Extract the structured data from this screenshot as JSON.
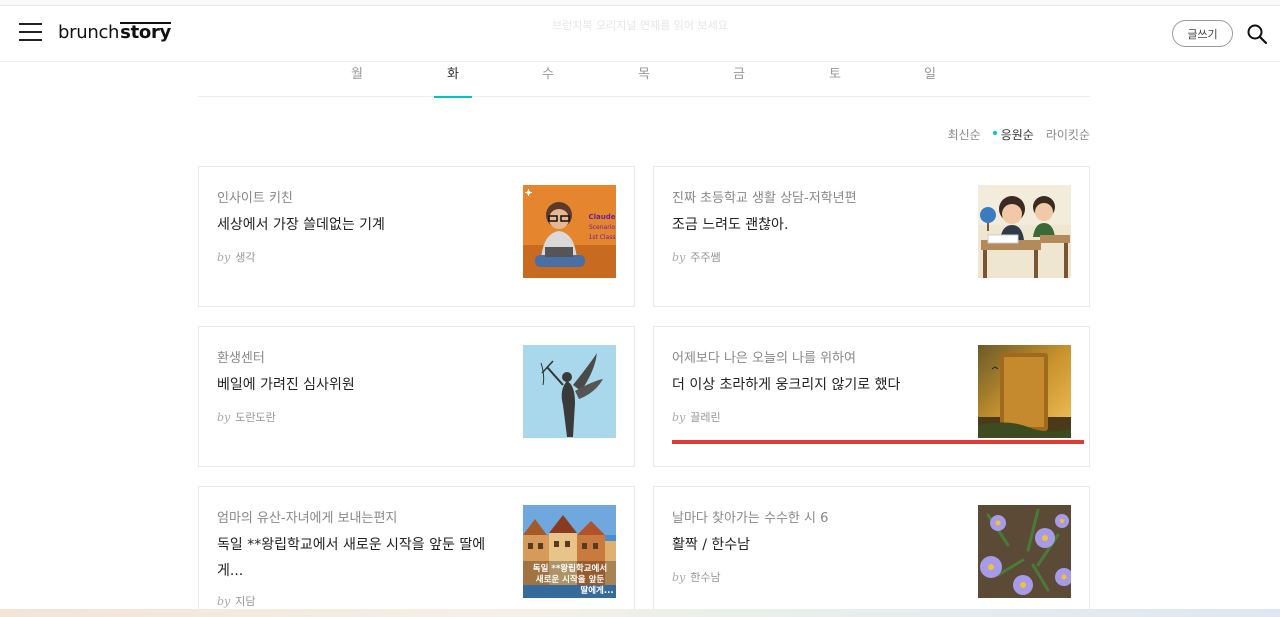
{
  "header": {
    "logo_part1": "brunch",
    "logo_part2": "story",
    "hint": "브런치북 오리지널 연재를 읽어 보세요",
    "write_label": "글쓰기"
  },
  "days": [
    "월",
    "화",
    "수",
    "목",
    "금",
    "토",
    "일"
  ],
  "active_day": "화",
  "sort": [
    "최신순",
    "응원순",
    "라이킷순"
  ],
  "active_sort": "응원순",
  "cards": [
    {
      "category": "인사이트 키친",
      "title": "세상에서 가장 쓸데없는 기계",
      "by": "by",
      "author": "생각",
      "thumb_text": [
        "Claude",
        "Scenario",
        "1st Class"
      ]
    },
    {
      "category": "진짜 초등학교 생활 상담-저학년편",
      "title": "조금 느려도 괜찮아.",
      "by": "by",
      "author": "주주쌤"
    },
    {
      "category": "환생센터",
      "title": "베일에 가려진 심사위원",
      "by": "by",
      "author": "도란도란"
    },
    {
      "category": "어제보다 나은 오늘의 나를 위하여",
      "title": "더 이상 초라하게 웅크리지 않기로 했다",
      "by": "by",
      "author": "끌레린"
    },
    {
      "category": "엄마의 유산-자녀에게 보내는편지",
      "title": "독일 **왕립학교에서 새로운 시작을 앞둔 딸에게...",
      "by": "by",
      "author": "지담",
      "thumb_text": [
        "독일 **왕립학교에서",
        "새로운 시작을 앞둔",
        "딸에게..."
      ]
    },
    {
      "category": "날마다 찾아가는 수수한 시 6",
      "title": "활짝 / 한수남",
      "by": "by",
      "author": "한수남"
    }
  ],
  "colors": {
    "accent": "#00c6be",
    "highlight": "#e03a3a"
  }
}
